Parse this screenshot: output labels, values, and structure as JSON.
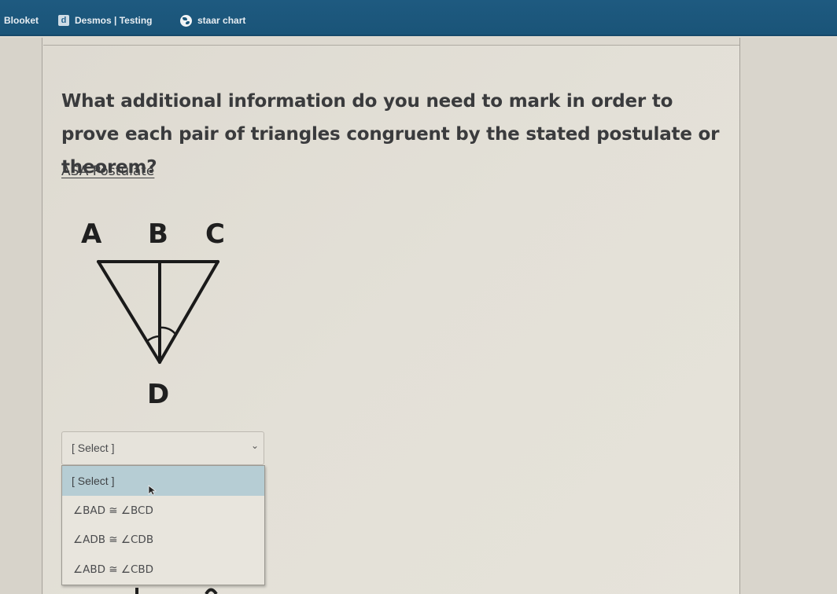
{
  "bookmarks": [
    {
      "label": "Blooket",
      "icon": "blooket-icon"
    },
    {
      "label": "Desmos | Testing",
      "icon": "desmos-d-icon"
    },
    {
      "label": "staar chart",
      "icon": "globe-icon"
    }
  ],
  "question": {
    "text": "What additional information do you need to mark in order to prove each pair of triangles congruent by the stated postulate or theorem?",
    "postulate_label": "ASA Postulate"
  },
  "diagram": {
    "labels": {
      "a": "A",
      "b": "B",
      "c": "C",
      "d": "D"
    }
  },
  "answer_select": {
    "selected": "[ Select ]",
    "options": [
      "[ Select ]",
      "∠BAD ≅ ∠BCD",
      "∠ADB ≅ ∠CDB",
      "∠ABD ≅ ∠CBD"
    ],
    "highlighted_index": 0
  },
  "colors": {
    "bookmark_bar": "#1c577b",
    "highlight": "#b6cdd4",
    "page_bg": "#e3e0d7"
  }
}
